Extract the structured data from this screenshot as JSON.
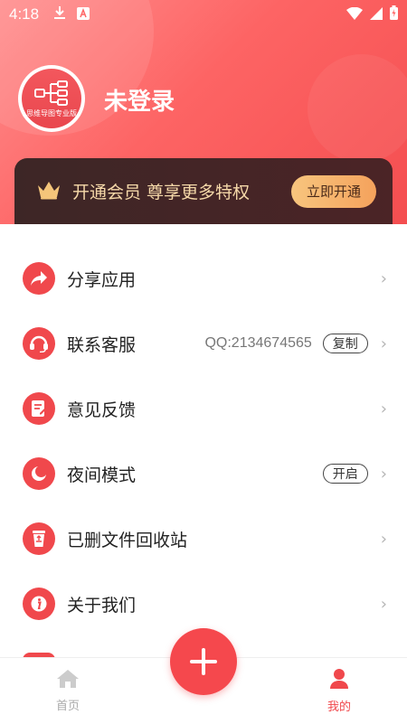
{
  "status_bar": {
    "time": "4:18"
  },
  "profile": {
    "login_status": "未登录",
    "avatar_text": "思维导图专业版"
  },
  "vip": {
    "promo_text": "开通会员 尊享更多特权",
    "button_label": "立即开通"
  },
  "menu": [
    {
      "label": "分享应用",
      "icon": "share-icon"
    },
    {
      "label": "联系客服",
      "icon": "headset-icon",
      "extra": "QQ:2134674565",
      "pill": "复制"
    },
    {
      "label": "意见反馈",
      "icon": "feedback-icon"
    },
    {
      "label": "夜间模式",
      "icon": "moon-icon",
      "pill": "开启"
    },
    {
      "label": "已删文件回收站",
      "icon": "recycle-bin-icon"
    },
    {
      "label": "关于我们",
      "icon": "info-icon"
    }
  ],
  "bottom_nav": {
    "home_label": "首页",
    "mine_label": "我的"
  },
  "colors": {
    "accent": "#f0484c",
    "vip_gold": "#f6d9a9"
  }
}
